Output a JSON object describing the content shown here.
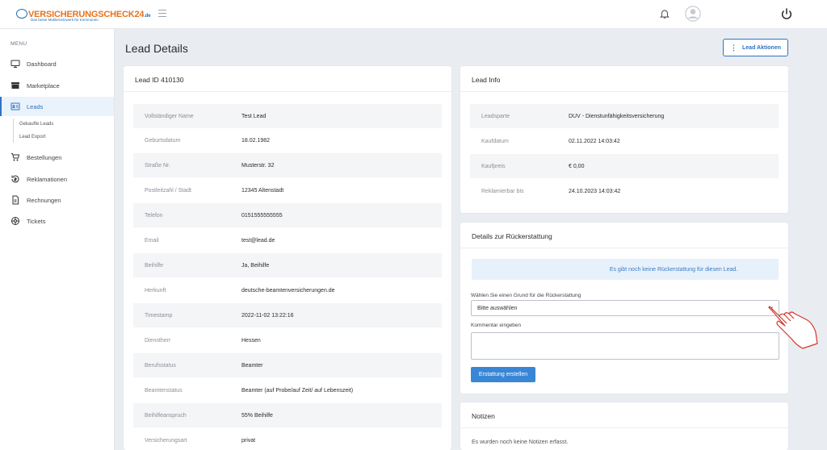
{
  "header": {
    "logo_text": "VERSICHERUNGSCHECK24",
    "logo_tld": ".de",
    "logo_tagline": "Das beste Maklernetzwerk für Kommunen"
  },
  "sidebar": {
    "menu_label": "MENU",
    "items": [
      {
        "label": "Dashboard",
        "icon": "monitor-icon"
      },
      {
        "label": "Marketplace",
        "icon": "store-icon"
      },
      {
        "label": "Leads",
        "icon": "id-card-icon",
        "active": true
      },
      {
        "label": "Bestellungen",
        "icon": "cart-icon"
      },
      {
        "label": "Reklamationen",
        "icon": "refund-icon"
      },
      {
        "label": "Rechnungen",
        "icon": "invoice-icon"
      },
      {
        "label": "Tickets",
        "icon": "lifebuoy-icon"
      }
    ],
    "sub_items": [
      "Gekaufte Leads",
      "Lead Export"
    ]
  },
  "main": {
    "title": "Lead Details",
    "actions_button": "Lead Aktionen"
  },
  "lead_card": {
    "title": "Lead ID 410130",
    "rows": [
      {
        "key": "Vollständiger Name",
        "value": "Test Lead"
      },
      {
        "key": "Geburtsdatum",
        "value": "18.02.1982"
      },
      {
        "key": "Straße Nr.",
        "value": "Musterstr. 32"
      },
      {
        "key": "Postleitzahl / Stadt",
        "value": "12345 Altenstadt"
      },
      {
        "key": "Telefon",
        "value": "0151555555555"
      },
      {
        "key": "Email",
        "value": "test@lead.de"
      },
      {
        "key": "Beihilfe",
        "value": "Ja, Beihilfe"
      },
      {
        "key": "Herkunft",
        "value": "deutsche-beamtenversicherungen.de"
      },
      {
        "key": "Timestamp",
        "value": "2022-11-02 13:22:16"
      },
      {
        "key": "Dienstherr",
        "value": "Hessen"
      },
      {
        "key": "Berufsstatus",
        "value": "Beamter"
      },
      {
        "key": "Beamtenstatus",
        "value": "Beamter (auf Probe/auf Zeit/ auf Lebenszeit)"
      },
      {
        "key": "Beihilfeanspruch",
        "value": "55% Beihilfe"
      },
      {
        "key": "Versicherungsart",
        "value": "privat"
      }
    ]
  },
  "info_card": {
    "title": "Lead Info",
    "rows": [
      {
        "key": "Leadsparte",
        "value": "DUV - Dienstunfähigkeitsversicherung"
      },
      {
        "key": "Kaufdatum",
        "value": "02.11.2022 14:03:42"
      },
      {
        "key": "Kaufpreis",
        "value": "€ 0,00"
      },
      {
        "key": "Reklamierbar bis",
        "value": "24.10.2023 14:03:42"
      }
    ]
  },
  "refund_card": {
    "title": "Details zur Rückerstattung",
    "notice": "Es gibt noch keine Rückerstattung für diesen Lead.",
    "reason_label": "Wählen Sie einen Grund für die Rückerstattung",
    "reason_selected": "Bitte auswählen",
    "comment_label": "Kommentar eingeben",
    "submit_label": "Erstattung erstellen"
  },
  "notes_card": {
    "title": "Notizen",
    "empty_text": "Es wurden noch keine Notizen erfasst."
  },
  "colors": {
    "accent": "#2e73c4",
    "primary_button": "#3a86d6",
    "logo_orange": "#e8731b",
    "page_bg": "#e9edf2"
  }
}
